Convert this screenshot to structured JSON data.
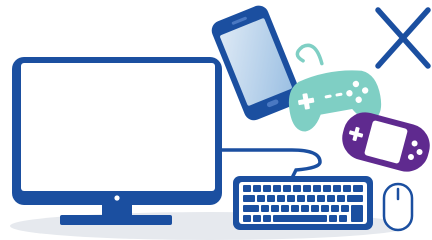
{
  "illustration": {
    "subjects": [
      "computer-monitor",
      "smartphone",
      "game-controller",
      "handheld-game-console",
      "keyboard",
      "mouse",
      "close-icon"
    ],
    "colors": {
      "primary_blue": "#1b4fa0",
      "screen_white": "#ffffff",
      "shadow_grey": "#e6e9ee",
      "phone_screen_light": "#dde9f5",
      "phone_screen_dark": "#9cc0e3",
      "controller_teal": "#7fcfc4",
      "console_purple": "#5f2a8f"
    }
  }
}
